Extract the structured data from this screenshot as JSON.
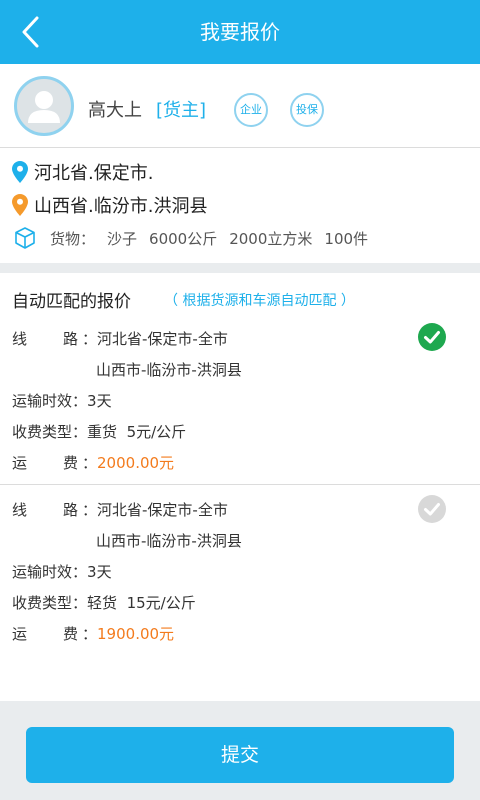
{
  "header": {
    "title": "我要报价",
    "back_icon": "chevron-left-icon"
  },
  "user": {
    "name": "高大上",
    "role": "[货主]",
    "badge_enterprise": "企业",
    "badge_insured": "投保"
  },
  "route": {
    "from": "河北省.保定市.",
    "to": "山西省.临汾市.洪洞县"
  },
  "cargo": {
    "label": "货物：",
    "name": "沙子",
    "weight": "6000公斤",
    "volume": "2000立方米",
    "count": "100件"
  },
  "quotes_section": {
    "title": "自动匹配的报价",
    "hint": "（ 根据货源和车源自动匹配 ）"
  },
  "labels": {
    "route": "线路",
    "transit": "运输时效",
    "fee_type": "收费类型",
    "freight": "运费",
    "colon": "："
  },
  "quotes": [
    {
      "route_line1": "河北省-保定市-全市",
      "route_line2": "山西市-临汾市-洪洞县",
      "transit": "3天",
      "fee_type": "重货  5元/公斤",
      "freight": "2000.00元",
      "selected": true
    },
    {
      "route_line1": "河北省-保定市-全市",
      "route_line2": "山西市-临汾市-洪洞县",
      "transit": "3天",
      "fee_type": "轻货  15元/公斤",
      "freight": "1900.00元",
      "selected": false
    }
  ],
  "submit": {
    "label": "提交"
  },
  "colors": {
    "primary": "#1eb0ea",
    "price": "#f37b1d",
    "selected_check": "#1ea84f",
    "unselected_check": "#d8d8d8",
    "pin_from": "#1eb0ea",
    "pin_to": "#f59a2c"
  }
}
